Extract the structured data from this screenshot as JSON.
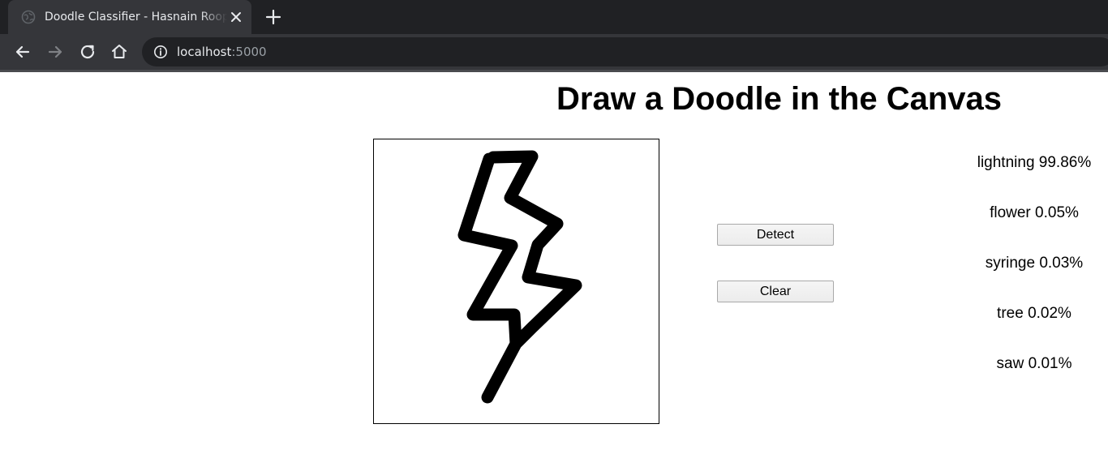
{
  "browser": {
    "tab": {
      "title": "Doodle Classifier - Hasnain Roopawalla"
    },
    "address": {
      "host": "localhost",
      "port": ":5000"
    },
    "icons": {
      "favicon": "globe-icon",
      "tab_close": "close-icon",
      "new_tab": "plus-icon",
      "back": "back-arrow-icon",
      "forward": "forward-arrow-icon",
      "reload": "reload-icon",
      "home": "home-icon",
      "site_info": "info-icon"
    },
    "colors": {
      "tab_strip": "#202124",
      "active_tab": "#35363a",
      "omnibox": "#202124",
      "text": "#e8eaed",
      "muted_text": "#9aa0a6"
    }
  },
  "page": {
    "heading": "Draw a Doodle in the Canvas",
    "buttons": {
      "detect": "Detect",
      "clear": "Clear"
    },
    "predictions": [
      {
        "label": "lightning",
        "percent": "99.86%"
      },
      {
        "label": "flower",
        "percent": "0.05%"
      },
      {
        "label": "syringe",
        "percent": "0.03%"
      },
      {
        "label": "tree",
        "percent": "0.02%"
      },
      {
        "label": "saw",
        "percent": "0.01%"
      }
    ]
  }
}
